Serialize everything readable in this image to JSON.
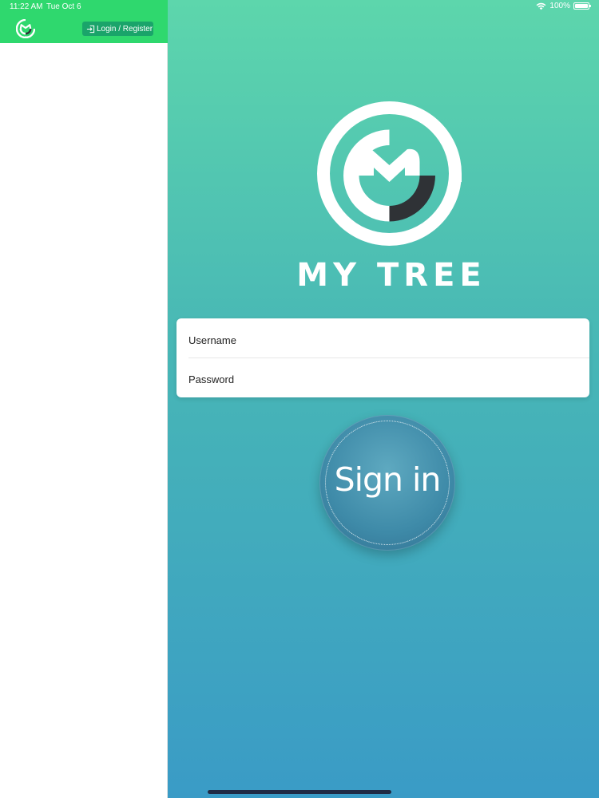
{
  "status_bar": {
    "time": "11:22 AM",
    "date": "Tue Oct 6",
    "battery": "100%",
    "icons": [
      "wifi-icon",
      "battery-icon"
    ]
  },
  "sidebar": {
    "logo_caption": "MY TREE",
    "login_label": "Login / Register",
    "colors": {
      "header_bg": "#2fd86e",
      "button_bg": "#1aa46a"
    }
  },
  "main": {
    "brand": "MY TREE",
    "username_placeholder": "Username",
    "password_placeholder": "Password",
    "signin_label": "Sign in",
    "colors": {
      "gradient_top": "#5dd6ac",
      "gradient_bottom": "#3a9bc6",
      "logo_accent": "#2f3236"
    }
  }
}
